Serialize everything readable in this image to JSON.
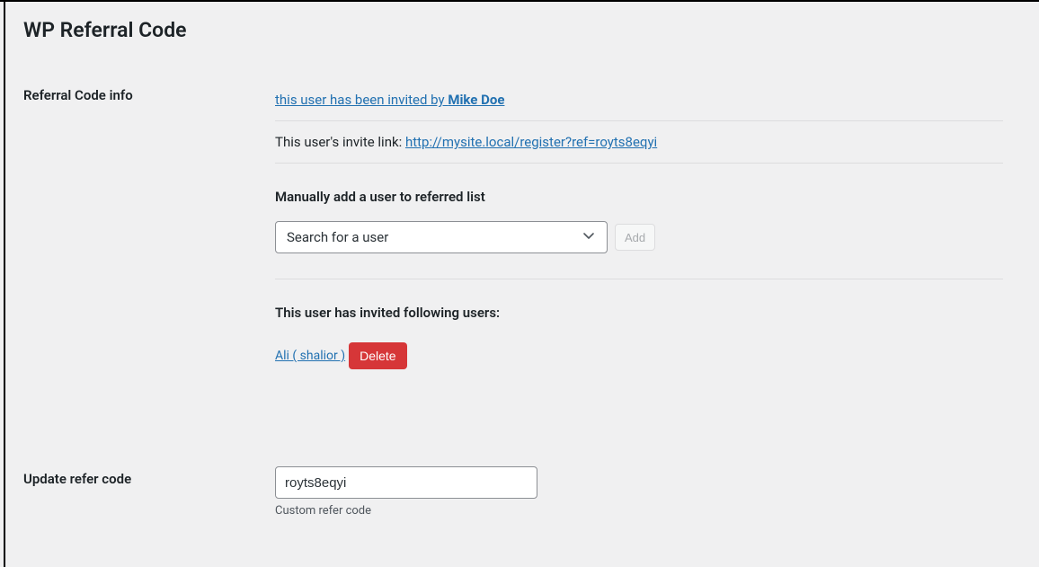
{
  "page": {
    "title": "WP Referral Code"
  },
  "referral": {
    "section_label": "Referral Code info",
    "invited_by_text": "this user has been invited by ",
    "invited_by_name": "Mike Doe",
    "invite_link_label": "This user's invite link: ",
    "invite_link_url": "http://mysite.local/register?ref=royts8eqyi",
    "manual_add_label": "Manually add a user to referred list",
    "search_placeholder": "Search for a user",
    "add_button_label": "Add",
    "invited_users_label": "This user has invited following users:",
    "invited_users": [
      {
        "label": "Ali ( shalior ) ",
        "delete_label": "Delete"
      }
    ]
  },
  "update": {
    "section_label": "Update refer code",
    "code_value": "royts8eqyi",
    "description": "Custom refer code"
  }
}
